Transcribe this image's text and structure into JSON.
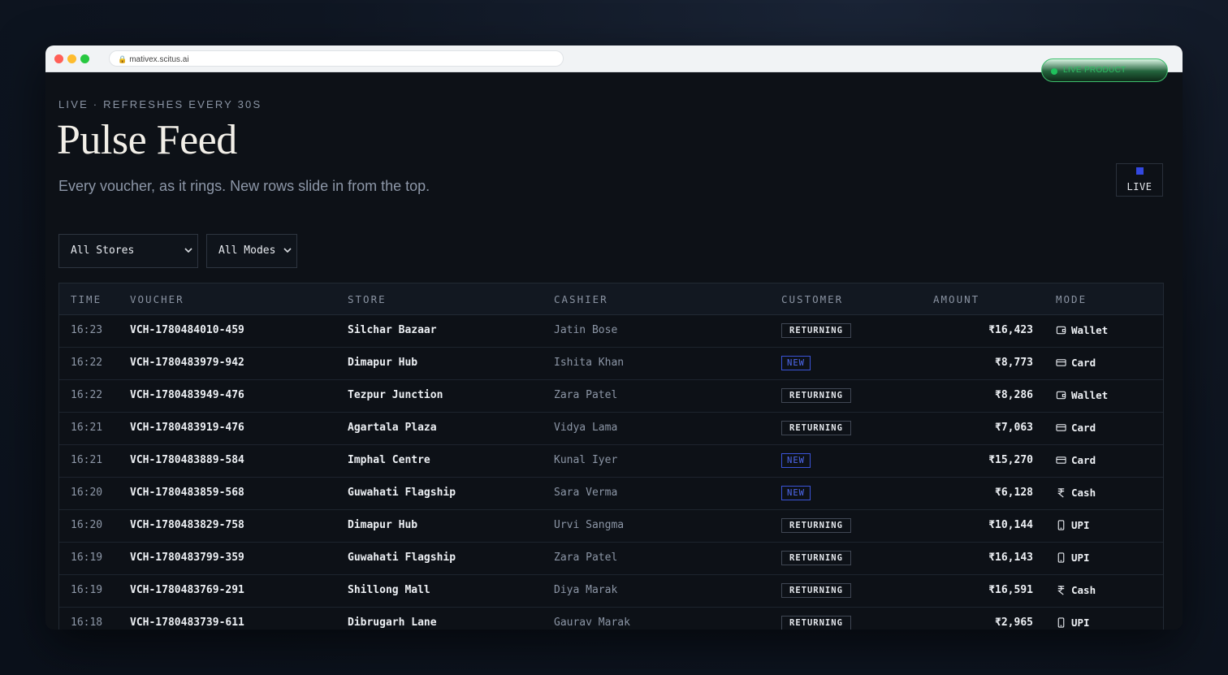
{
  "browser": {
    "url": "mativex.scitus.ai"
  },
  "live_product_label": "LIVE PRODUCT",
  "header": {
    "eyebrow": "LIVE · REFRESHES EVERY 30S",
    "title": "Pulse Feed",
    "subtitle": "Every voucher, as it rings. New rows slide in from the top.",
    "live_badge": "LIVE"
  },
  "filters": {
    "store": "All Stores",
    "mode": "All Modes"
  },
  "colors": {
    "accent": "#3348e0",
    "new_tag": "#4f69f0",
    "live_green": "#1fc25c"
  },
  "table": {
    "columns": [
      "TIME",
      "VOUCHER",
      "STORE",
      "CASHIER",
      "CUSTOMER",
      "AMOUNT",
      "MODE"
    ],
    "rows": [
      {
        "time": "16:23",
        "voucher": "VCH-1780484010-459",
        "store": "Silchar Bazaar",
        "cashier": "Jatin Bose",
        "customer": "RETURNING",
        "amount": "₹16,423",
        "mode": "Wallet",
        "mode_icon": "wallet-icon"
      },
      {
        "time": "16:22",
        "voucher": "VCH-1780483979-942",
        "store": "Dimapur Hub",
        "cashier": "Ishita Khan",
        "customer": "NEW",
        "amount": "₹8,773",
        "mode": "Card",
        "mode_icon": "card-icon"
      },
      {
        "time": "16:22",
        "voucher": "VCH-1780483949-476",
        "store": "Tezpur Junction",
        "cashier": "Zara Patel",
        "customer": "RETURNING",
        "amount": "₹8,286",
        "mode": "Wallet",
        "mode_icon": "wallet-icon"
      },
      {
        "time": "16:21",
        "voucher": "VCH-1780483919-476",
        "store": "Agartala Plaza",
        "cashier": "Vidya Lama",
        "customer": "RETURNING",
        "amount": "₹7,063",
        "mode": "Card",
        "mode_icon": "card-icon"
      },
      {
        "time": "16:21",
        "voucher": "VCH-1780483889-584",
        "store": "Imphal Centre",
        "cashier": "Kunal Iyer",
        "customer": "NEW",
        "amount": "₹15,270",
        "mode": "Card",
        "mode_icon": "card-icon"
      },
      {
        "time": "16:20",
        "voucher": "VCH-1780483859-568",
        "store": "Guwahati Flagship",
        "cashier": "Sara Verma",
        "customer": "NEW",
        "amount": "₹6,128",
        "mode": "Cash",
        "mode_icon": "rupee-icon"
      },
      {
        "time": "16:20",
        "voucher": "VCH-1780483829-758",
        "store": "Dimapur Hub",
        "cashier": "Urvi Sangma",
        "customer": "RETURNING",
        "amount": "₹10,144",
        "mode": "UPI",
        "mode_icon": "phone-icon"
      },
      {
        "time": "16:19",
        "voucher": "VCH-1780483799-359",
        "store": "Guwahati Flagship",
        "cashier": "Zara Patel",
        "customer": "RETURNING",
        "amount": "₹16,143",
        "mode": "UPI",
        "mode_icon": "phone-icon"
      },
      {
        "time": "16:19",
        "voucher": "VCH-1780483769-291",
        "store": "Shillong Mall",
        "cashier": "Diya Marak",
        "customer": "RETURNING",
        "amount": "₹16,591",
        "mode": "Cash",
        "mode_icon": "rupee-icon"
      },
      {
        "time": "16:18",
        "voucher": "VCH-1780483739-611",
        "store": "Dibrugarh Lane",
        "cashier": "Gaurav Marak",
        "customer": "RETURNING",
        "amount": "₹2,965",
        "mode": "UPI",
        "mode_icon": "phone-icon"
      }
    ]
  }
}
